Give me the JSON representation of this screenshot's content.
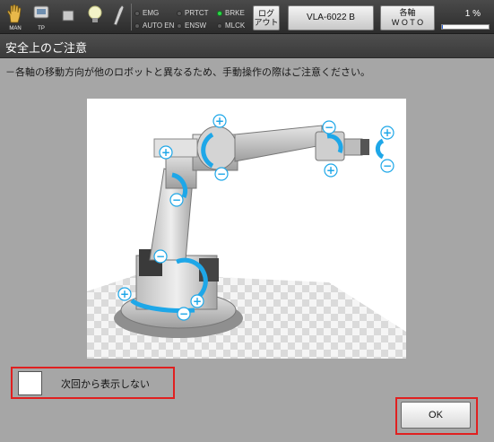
{
  "toolbar": {
    "mode_label": "MAN",
    "tp_label": "TP",
    "status": {
      "emg": "EMG",
      "prtct": "PRTCT",
      "brke": "BRKE",
      "auto_en": "AUTO EN",
      "ensw": "ENSW",
      "mlck": "MLCK",
      "active_lamp": "BRKE"
    },
    "logout_line1": "ログ",
    "logout_line2": "アウト",
    "robot_name": "VLA-6022 B",
    "axis_line1": "各軸",
    "axis_line2": "W O T O",
    "override_text": "1 %",
    "override_value": 0.01
  },
  "dialog": {
    "title": "安全上のご注意",
    "message": "－各軸の移動方向が他のロボットと異なるため、手動操作の際はご注意ください。",
    "checkbox_label": "次回から表示しない",
    "checkbox_checked": false,
    "ok_label": "OK"
  },
  "colors": {
    "accent_arrows": "#1ea7e8",
    "highlight_outline": "#e02020",
    "status_on": "#2ed44a"
  },
  "icons": [
    "hand-icon",
    "teach-pendant-icon",
    "stop-square-icon",
    "lightbulb-icon",
    "wrench-icon"
  ]
}
